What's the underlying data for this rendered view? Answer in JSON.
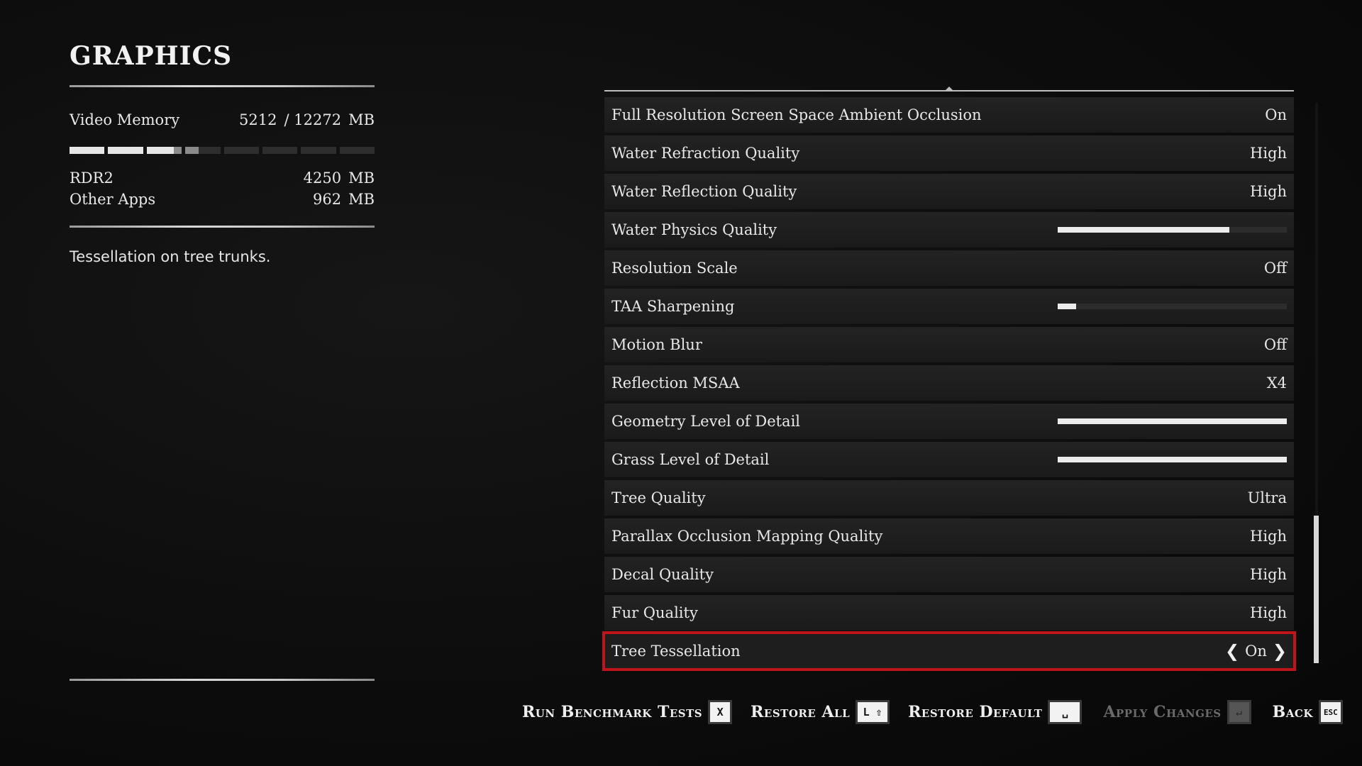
{
  "panel": {
    "title": "GRAPHICS",
    "video_memory_label": "Video Memory",
    "video_memory_used": "5212",
    "video_memory_total": "/ 12272",
    "video_memory_unit": "MB",
    "usage_fraction_rdr2": 0.346,
    "usage_fraction_other": 0.078,
    "rdr2_label": "RDR2",
    "rdr2_value": "4250",
    "rdr2_unit": "MB",
    "other_label": "Other Apps",
    "other_value": "962",
    "other_unit": "MB",
    "description": "Tessellation on tree trunks."
  },
  "settings": [
    {
      "label": "Full Resolution Screen Space Ambient Occlusion",
      "value": "On"
    },
    {
      "label": "Water Refraction Quality",
      "value": "High"
    },
    {
      "label": "Water Reflection Quality",
      "value": "High"
    },
    {
      "label": "Water Physics Quality",
      "slider": 0.75
    },
    {
      "label": "Resolution Scale",
      "value": "Off"
    },
    {
      "label": "TAA Sharpening",
      "slider": 0.08
    },
    {
      "label": "Motion Blur",
      "value": "Off"
    },
    {
      "label": "Reflection MSAA",
      "value": "X4"
    },
    {
      "label": "Geometry Level of Detail",
      "slider": 1.0
    },
    {
      "label": "Grass Level of Detail",
      "slider": 1.0
    },
    {
      "label": "Tree Quality",
      "value": "Ultra"
    },
    {
      "label": "Parallax Occlusion Mapping Quality",
      "value": "High"
    },
    {
      "label": "Decal Quality",
      "value": "High"
    },
    {
      "label": "Fur Quality",
      "value": "High"
    },
    {
      "label": "Tree Tessellation",
      "value": "On",
      "selected": true
    }
  ],
  "footer": {
    "run_benchmark": "Run Benchmark Tests",
    "run_benchmark_key": "X",
    "restore_all": "Restore All",
    "restore_all_key": "L ⇧",
    "restore_default": "Restore Default",
    "restore_default_key": "␣",
    "apply_changes": "Apply Changes",
    "apply_changes_key": "↵",
    "back": "Back",
    "back_key": "ESC"
  },
  "colors": {
    "selection_border": "#c0141b"
  }
}
